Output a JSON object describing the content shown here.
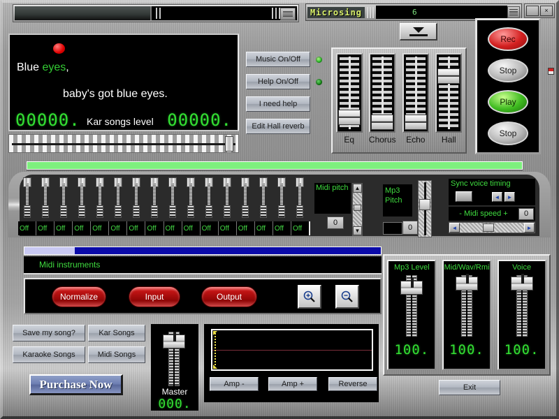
{
  "window": {
    "app_title": "Microsing",
    "title_field_value": "6",
    "minimize_label": "",
    "close_label": "×"
  },
  "lyrics": {
    "line1_sung": "Blue ",
    "line1_current": "eyes",
    "line1_rest": ",",
    "line2": "baby's got blue eyes.",
    "level_left": "00000.",
    "level_right": "00000.",
    "level_label": "Kar songs level"
  },
  "controls": {
    "music_onoff": "Music On/Off",
    "help_onoff": "Help On/Off",
    "i_need_help": "I need help",
    "edit_hall_reverb": "Edit Hall reverb"
  },
  "fx": {
    "faders": [
      {
        "label": "Eq",
        "position_pct": 18
      },
      {
        "label": "Chorus",
        "position_pct": 12
      },
      {
        "label": "Echo",
        "position_pct": 12
      },
      {
        "label": "Hall",
        "position_pct": 72
      }
    ]
  },
  "transport": {
    "rec": "Rec",
    "stop_top": "Stop",
    "play": "Play",
    "stop_bottom": "Stop"
  },
  "midi": {
    "channel_count": 16,
    "channel_states": [
      "Off",
      "Off",
      "Off",
      "Off",
      "Off",
      "Off",
      "Off",
      "Off",
      "Off",
      "Off",
      "Off",
      "Off",
      "Off",
      "Off",
      "Off",
      "Off"
    ],
    "instruments_label": "Midi instruments",
    "progress_pct": 14
  },
  "pitch": {
    "midi_pitch_label": "Midi pitch",
    "midi_pitch_value": "0",
    "mp3_pitch_label_line1": "Mp3",
    "mp3_pitch_label_line2": "Pitch",
    "mp3_pitch_value": "0",
    "spin_up": "▲",
    "spin_down": "▼"
  },
  "sync": {
    "title": "Sync voice timing",
    "prev_arrow": "◄",
    "next_arrow": "►",
    "midi_speed_label": "-  Midi speed  +",
    "midi_speed_value": "0"
  },
  "io": {
    "normalize": "Normalize",
    "input": "Input",
    "output": "Output",
    "zoom_in": "zoom-in-icon",
    "zoom_out": "zoom-out-icon"
  },
  "levels": [
    {
      "title": "Mp3  Level",
      "value": "100.",
      "position_pct": 88
    },
    {
      "title": "Mid/Wav/Rmi",
      "value": "100.",
      "position_pct": 93
    },
    {
      "title": "Voice",
      "value": "100.",
      "position_pct": 93
    }
  ],
  "songs": {
    "save_my_song": "Save my song?",
    "kar_songs": "Kar Songs",
    "karaoke_songs": "Karaoke Songs",
    "midi_songs": "Midi Songs",
    "purchase_now": "Purchase Now"
  },
  "master": {
    "label": "Master",
    "value": "000.",
    "position_pct": 88
  },
  "wave": {
    "amp_minus": "Amp -",
    "amp_plus": "Amp +",
    "reverse": "Reverse"
  },
  "footer": {
    "exit": "Exit"
  },
  "colors": {
    "lcd_green": "#33e033",
    "label_green": "#3fdc3f",
    "record_red": "#e00000",
    "play_green": "#3fbb20",
    "progress_blue": "#0a0aa8",
    "banner_green": "#7ef07e"
  }
}
